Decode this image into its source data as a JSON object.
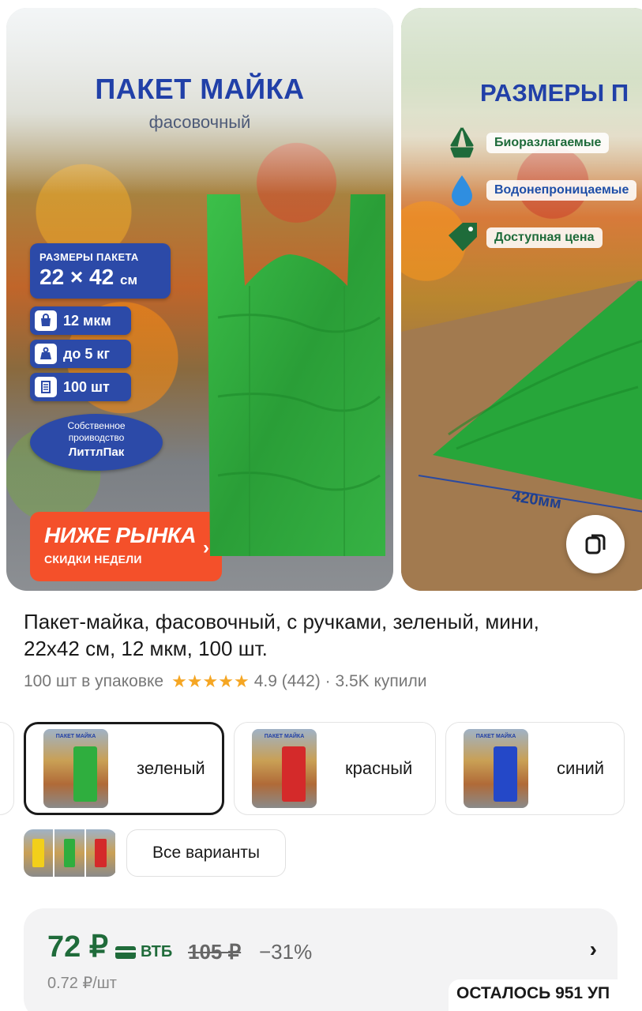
{
  "gallery": {
    "slide1": {
      "title": "ПАКЕТ МАЙКА",
      "subtitle": "фасовочный",
      "size_label": "РАЗМЕРЫ ПАКЕТА",
      "size_value": "22 × 42",
      "size_unit": "см",
      "specs": [
        {
          "icon": "bag-icon",
          "text": "12 мкм"
        },
        {
          "icon": "weight-icon",
          "text": "до 5 кг"
        },
        {
          "icon": "stack-icon",
          "text": "100 шт"
        }
      ],
      "own_production_line1": "Собственное",
      "own_production_line2": "проиводство",
      "brand": "ЛиттлПак",
      "promo_title": "НИЖЕ РЫНКА",
      "promo_subtitle": "СКИДКИ НЕДЕЛИ",
      "bag_color": "#2fae3e"
    },
    "slide2": {
      "title": "РАЗМЕРЫ П",
      "features": [
        {
          "icon": "recycle-icon",
          "text": "Биоразлагаемые"
        },
        {
          "icon": "water-drop-icon",
          "text": "Водонепроницаемые"
        },
        {
          "icon": "price-tag-icon",
          "text": "Доступная цена"
        }
      ],
      "dimension": "420мм"
    }
  },
  "product": {
    "title": "Пакет-майка, фасовочный, с ручками, зеленый, мини, 22х42 см, 12 мкм, 100 шт.",
    "pack_info": "100 шт в упаковке",
    "stars": "★★★★★",
    "rating": "4.9",
    "reviews": "(442)",
    "separator": "·",
    "bought": "3.5K купили"
  },
  "variants": [
    {
      "label": "зеленый",
      "color": "#2fae3e",
      "selected": true
    },
    {
      "label": "красный",
      "color": "#d42a2a",
      "selected": false
    },
    {
      "label": "синий",
      "color": "#2448c8",
      "selected": false
    }
  ],
  "mini_colors": [
    "#f2cf1a",
    "#2fae3e",
    "#d42a2a"
  ],
  "all_variants_label": "Все варианты",
  "price": {
    "current": "72 ₽",
    "bank": "ВТБ",
    "old": "105 ₽",
    "discount": "−31%",
    "per_unit": "0.72 ₽/шт",
    "stock": "ОСТАЛОСЬ 951 УП"
  },
  "colors": {
    "accent_green": "#1f6b3a",
    "brand_blue": "#2140a8",
    "promo_orange": "#f4502a"
  }
}
